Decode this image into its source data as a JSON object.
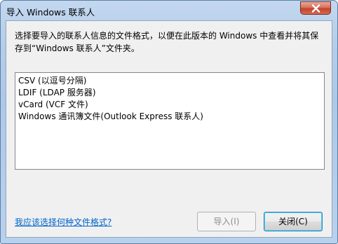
{
  "window": {
    "title": "导入 Windows 联系人",
    "close_icon": "close-icon"
  },
  "description": {
    "line1": "选择要导入的联系人信息的文件格式，以便在此版本的 Windows 中查看并将其保",
    "line2": "存到“Windows 联系人”文件夹。"
  },
  "formats": [
    {
      "label": "CSV (以逗号分隔)"
    },
    {
      "label": "LDIF (LDAP 服务器)"
    },
    {
      "label": "vCard (VCF 文件)"
    },
    {
      "label": "Windows 通讯簿文件(Outlook Express 联系人)"
    }
  ],
  "help_link": "我应该选择何种文件格式?",
  "buttons": {
    "import": "导入(I)",
    "close": "关闭(C)"
  },
  "colors": {
    "link": "#0066cc",
    "disabled_text": "#8d8d8d",
    "close_button": "#c2432a"
  }
}
